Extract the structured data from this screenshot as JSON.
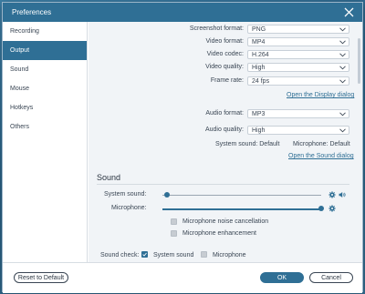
{
  "window": {
    "title": "Preferences"
  },
  "sidebar": {
    "items": [
      {
        "label": "Recording",
        "active": false
      },
      {
        "label": "Output",
        "active": true
      },
      {
        "label": "Sound",
        "active": false
      },
      {
        "label": "Mouse",
        "active": false
      },
      {
        "label": "Hotkeys",
        "active": false
      },
      {
        "label": "Others",
        "active": false
      }
    ]
  },
  "output": {
    "screenshot_format": {
      "label": "Screenshot format:",
      "value": "PNG"
    },
    "video_format": {
      "label": "Video format:",
      "value": "MP4"
    },
    "video_codec": {
      "label": "Video codec:",
      "value": "H.264"
    },
    "video_quality": {
      "label": "Video quality:",
      "value": "High"
    },
    "frame_rate": {
      "label": "Frame rate:",
      "value": "24 fps"
    },
    "display_dialog_link": "Open the Display dialog",
    "audio_format": {
      "label": "Audio format:",
      "value": "MP3"
    },
    "audio_quality": {
      "label": "Audio quality:",
      "value": "High"
    },
    "system_sound_status": "System sound:  Default",
    "microphone_status": "Microphone:  Default",
    "sound_dialog_link": "Open the Sound dialog"
  },
  "sound": {
    "title": "Sound",
    "system_sound_label": "System sound:",
    "system_sound_level": 0.03,
    "microphone_label": "Microphone:",
    "microphone_level": 1.0,
    "noise_cancellation_label": "Microphone noise cancellation",
    "noise_cancellation_checked": false,
    "enhancement_label": "Microphone enhancement",
    "enhancement_checked": false,
    "sound_check_label": "Sound check:",
    "check_system_sound_label": "System sound",
    "check_system_sound_checked": true,
    "check_microphone_label": "Microphone",
    "check_microphone_checked": false
  },
  "footer": {
    "reset_label": "Reset to Default",
    "ok_label": "OK",
    "cancel_label": "Cancel"
  },
  "colors": {
    "accent": "#2f6f95",
    "link": "#2f6f95"
  }
}
